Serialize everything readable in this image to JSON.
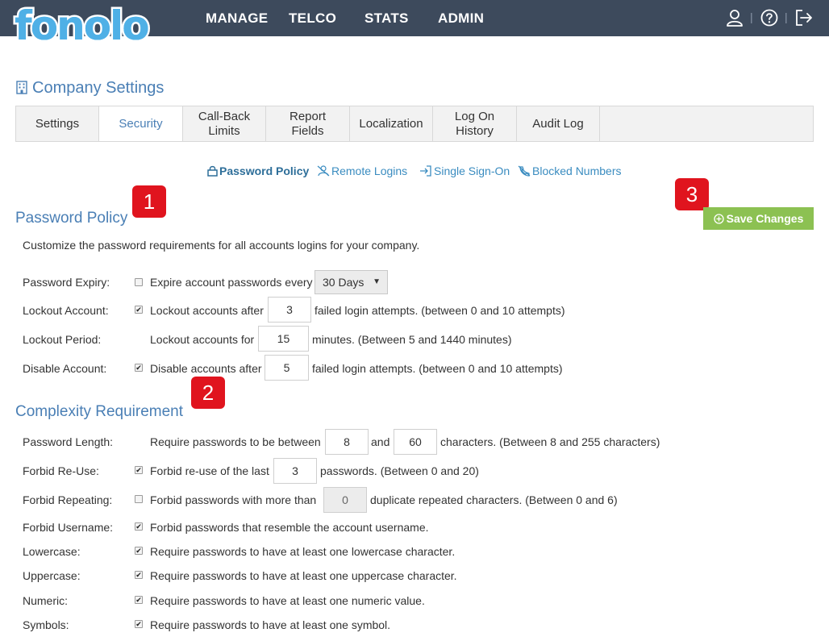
{
  "brand": {
    "logo_text": "fonolo"
  },
  "nav": {
    "manage": "MANAGE",
    "telco": "TELCO",
    "stats": "STATS",
    "admin": "ADMIN",
    "sep1": "|",
    "sep2": "|"
  },
  "page": {
    "title": "Company Settings"
  },
  "tabs": [
    {
      "label": "Settings"
    },
    {
      "label": "Security"
    },
    {
      "label_line1": "Call-Back",
      "label_line2": "Limits"
    },
    {
      "label_line1": "Report",
      "label_line2": "Fields"
    },
    {
      "label": "Localization"
    },
    {
      "label_line1": "Log On",
      "label_line2": "History"
    },
    {
      "label": "Audit Log"
    }
  ],
  "subnav": {
    "password_policy": "Password Policy",
    "remote_logins": "Remote Logins",
    "single_sign_on": "Single Sign-On",
    "blocked_numbers": "Blocked Numbers"
  },
  "badges": {
    "b1": "1",
    "b2": "2",
    "b3": "3"
  },
  "password_policy": {
    "title": "Password Policy",
    "description": "Customize the password requirements for all accounts logins for your company.",
    "save_label": "Save Changes",
    "expiry": {
      "label": "Password Expiry:",
      "checked": false,
      "text": "Expire account passwords every",
      "selected": "30 Days"
    },
    "lockout": {
      "label": "Lockout Account:",
      "checked": true,
      "pre": "Lockout accounts after",
      "value": "3",
      "post": "failed login attempts. (between 0 and 10 attempts)"
    },
    "period": {
      "label": "Lockout Period:",
      "pre": "Lockout accounts for",
      "value": "15",
      "post": "minutes. (Between 5 and 1440 minutes)"
    },
    "disable": {
      "label": "Disable Account:",
      "checked": true,
      "pre": "Disable accounts after",
      "value": "5",
      "post": "failed login attempts. (between 0 and 10 attempts)"
    }
  },
  "complexity": {
    "title": "Complexity Requirement",
    "length": {
      "label": "Password Length:",
      "pre": "Require passwords to be between",
      "min": "8",
      "mid": "and",
      "max": "60",
      "post": "characters. (Between 8 and 255 characters)"
    },
    "reuse": {
      "label": "Forbid Re-Use:",
      "checked": true,
      "pre": "Forbid re-use of the last",
      "value": "3",
      "post": "passwords. (Between 0 and 20)"
    },
    "repeating": {
      "label": "Forbid Repeating:",
      "checked": false,
      "pre": "Forbid passwords with more than",
      "value": "0",
      "post": "duplicate repeated characters. (Between 0 and 6)"
    },
    "username": {
      "label": "Forbid Username:",
      "checked": true,
      "text": "Forbid passwords that resemble the account username."
    },
    "lowercase": {
      "label": "Lowercase:",
      "checked": true,
      "text": "Require passwords to have at least one lowercase character."
    },
    "uppercase": {
      "label": "Uppercase:",
      "checked": true,
      "text": "Require passwords to have at least one uppercase character."
    },
    "numeric": {
      "label": "Numeric:",
      "checked": true,
      "text": "Require passwords to have at least one numeric value."
    },
    "symbols": {
      "label": "Symbols:",
      "checked": true,
      "text": "Require passwords to have at least one symbol."
    }
  },
  "colors": {
    "topbar": "#3d4a5c",
    "accent": "#4a7fb5",
    "link": "#3a8cc0",
    "save": "#8cc152",
    "badge": "#e0141e"
  }
}
